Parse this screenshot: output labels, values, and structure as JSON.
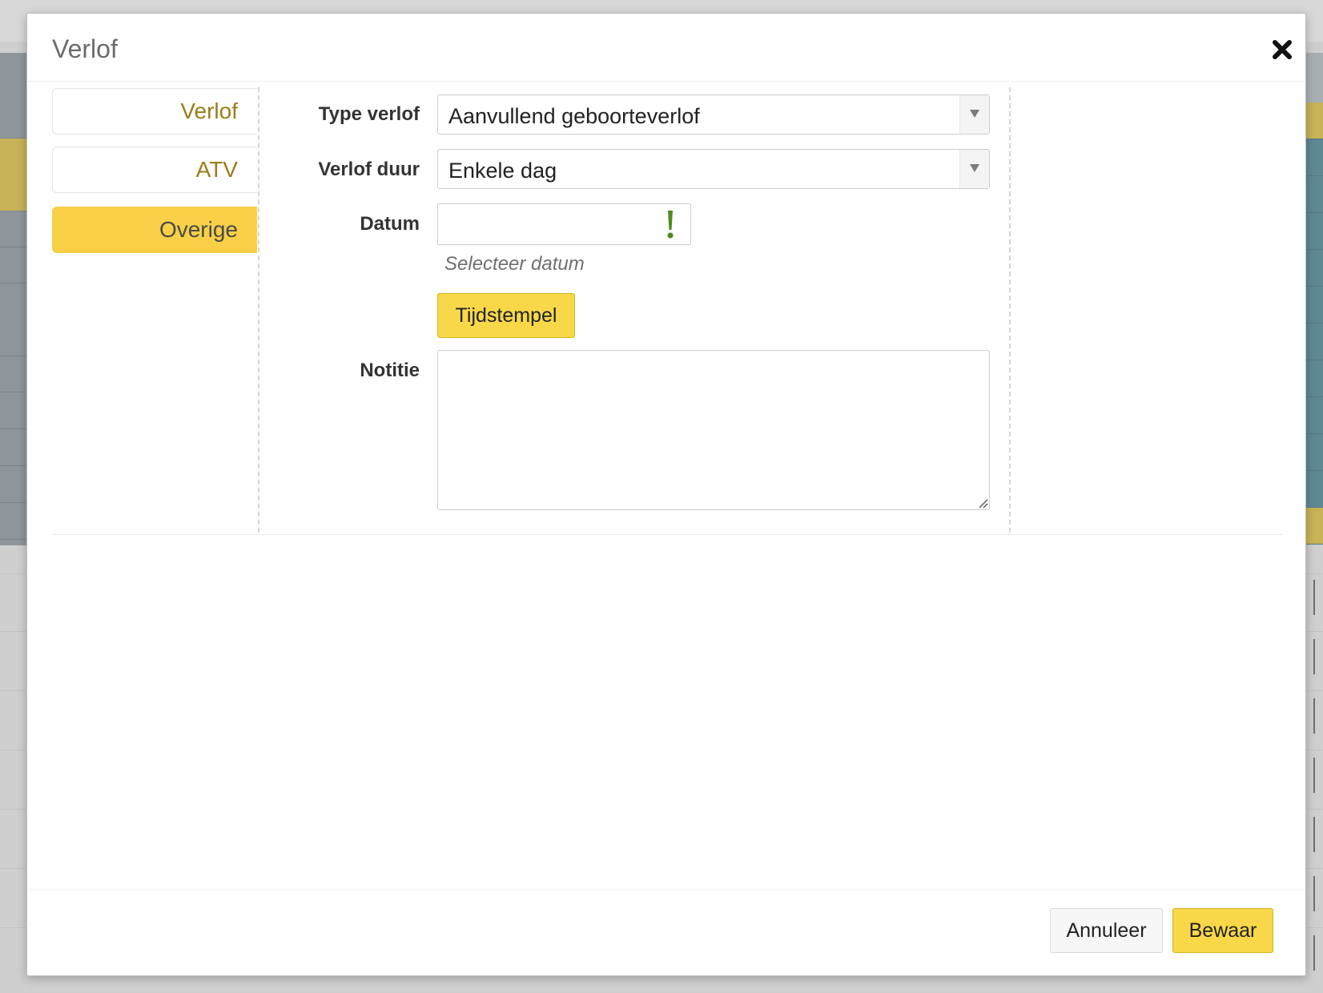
{
  "modal": {
    "title": "Verlof"
  },
  "tabs": [
    {
      "label": "Verlof",
      "active": false
    },
    {
      "label": "ATV",
      "active": false
    },
    {
      "label": "Overige",
      "active": true
    }
  ],
  "form": {
    "type_label": "Type verlof",
    "type_value": "Aanvullend geboorteverlof",
    "duur_label": "Verlof duur",
    "duur_value": "Enkele dag",
    "datum_label": "Datum",
    "datum_value": "",
    "datum_help": "Selecteer datum",
    "timestamp_button": "Tijdstempel",
    "notitie_label": "Notitie",
    "notitie_value": ""
  },
  "footer": {
    "cancel_label": "Annuleer",
    "save_label": "Bewaar"
  },
  "colors": {
    "accent": "#f8cf47",
    "tab_text": "#9a7d1a",
    "warning_icon": "#4e8a1e"
  },
  "icons": {
    "close": "close-icon",
    "select_arrow": "chevron-down-icon",
    "date_warning": "exclamation-icon",
    "resize": "resize-grip-icon"
  }
}
